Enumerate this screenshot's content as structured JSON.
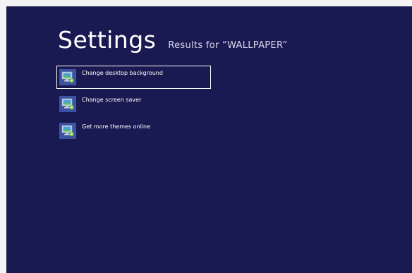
{
  "header": {
    "title": "Settings",
    "subtitle": "Results for “WALLPAPER”"
  },
  "results": [
    {
      "label": "Change desktop background",
      "icon": "display-settings-icon",
      "selected": true
    },
    {
      "label": "Change screen saver",
      "icon": "display-settings-icon",
      "selected": false
    },
    {
      "label": "Get more themes online",
      "icon": "display-settings-icon",
      "selected": false
    }
  ],
  "colors": {
    "background": "#1a1a52",
    "icon_tile": "#3d52a0",
    "selection_border": "#ffffff",
    "text": "#ffffff"
  }
}
